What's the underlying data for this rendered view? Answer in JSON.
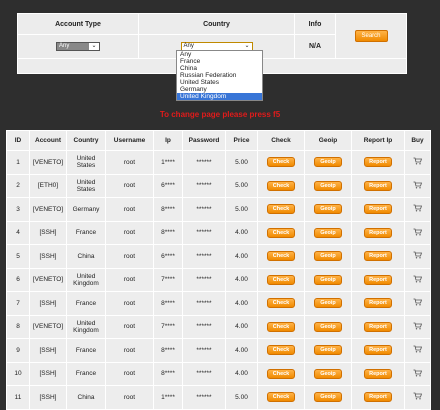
{
  "filter": {
    "headers": {
      "account_type": "Account Type",
      "country": "Country",
      "info": "Info"
    },
    "account_type_value": "Any",
    "country_value": "Any",
    "info_value": "N/A",
    "search_label": "Search",
    "country_options": [
      "Any",
      "France",
      "China",
      "Russian Federation",
      "United States",
      "Germany",
      "United Kingdom"
    ],
    "country_highlighted": "United Kingdom"
  },
  "notice": "To change page please press f5",
  "table": {
    "headers": {
      "id": "ID",
      "account": "Account",
      "country": "Country",
      "username": "Username",
      "ip": "Ip",
      "password": "Password",
      "price": "Price",
      "check": "Check",
      "geoip": "Geoip",
      "report": "Report Ip",
      "buy": "Buy"
    },
    "button_labels": {
      "check": "Check",
      "geoip": "Geoip",
      "report": "Report"
    },
    "rows": [
      {
        "id": "1",
        "account": "[VENETO]",
        "country_l1": "United",
        "country_l2": "States",
        "username": "root",
        "ip": "1****",
        "password": "******",
        "price": "5.00"
      },
      {
        "id": "2",
        "account": "[ETH0]",
        "country_l1": "United",
        "country_l2": "States",
        "username": "root",
        "ip": "6****",
        "password": "******",
        "price": "5.00"
      },
      {
        "id": "3",
        "account": "[VENETO]",
        "country_l1": "Germany",
        "country_l2": "",
        "username": "root",
        "ip": "8****",
        "password": "******",
        "price": "5.00"
      },
      {
        "id": "4",
        "account": "[SSH]",
        "country_l1": "France",
        "country_l2": "",
        "username": "root",
        "ip": "8****",
        "password": "******",
        "price": "4.00"
      },
      {
        "id": "5",
        "account": "[SSH]",
        "country_l1": "China",
        "country_l2": "",
        "username": "root",
        "ip": "6****",
        "password": "******",
        "price": "4.00"
      },
      {
        "id": "6",
        "account": "[VENETO]",
        "country_l1": "United",
        "country_l2": "Kingdom",
        "username": "root",
        "ip": "7****",
        "password": "******",
        "price": "4.00"
      },
      {
        "id": "7",
        "account": "[SSH]",
        "country_l1": "France",
        "country_l2": "",
        "username": "root",
        "ip": "8****",
        "password": "******",
        "price": "4.00"
      },
      {
        "id": "8",
        "account": "[VENETO]",
        "country_l1": "United",
        "country_l2": "Kingdom",
        "username": "root",
        "ip": "7****",
        "password": "******",
        "price": "4.00"
      },
      {
        "id": "9",
        "account": "[SSH]",
        "country_l1": "France",
        "country_l2": "",
        "username": "root",
        "ip": "8****",
        "password": "******",
        "price": "4.00"
      },
      {
        "id": "10",
        "account": "[SSH]",
        "country_l1": "France",
        "country_l2": "",
        "username": "root",
        "ip": "8****",
        "password": "******",
        "price": "4.00"
      },
      {
        "id": "11",
        "account": "[SSH]",
        "country_l1": "China",
        "country_l2": "",
        "username": "root",
        "ip": "1****",
        "password": "******",
        "price": "5.00"
      }
    ]
  }
}
